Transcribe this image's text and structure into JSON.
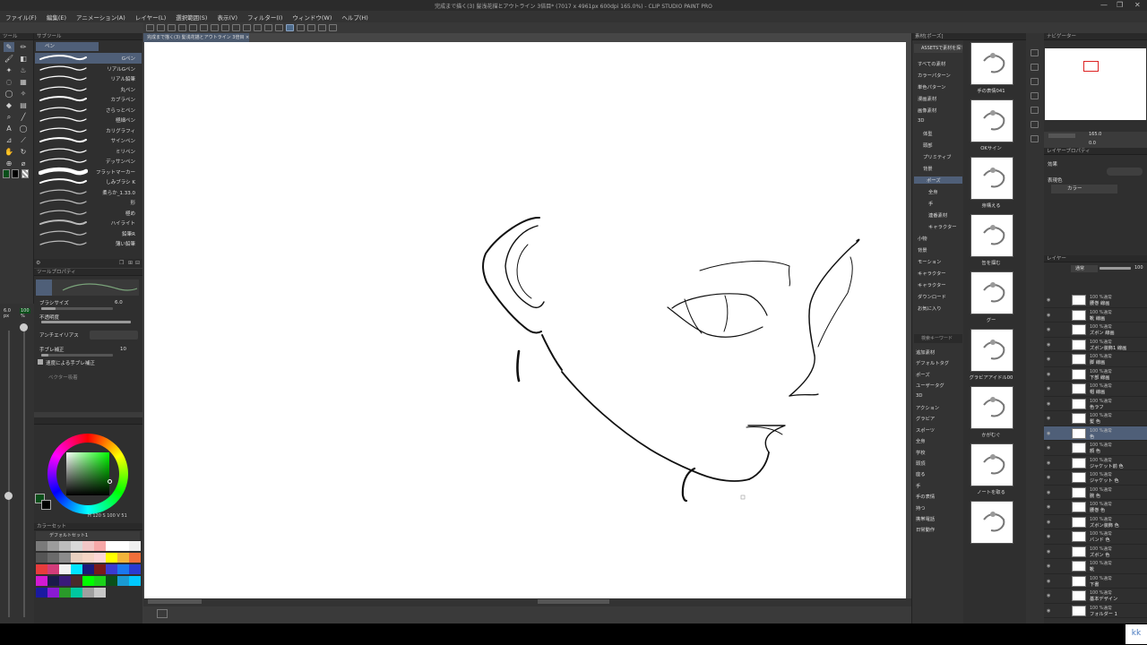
{
  "title_bar": {
    "text": "完成まで描く(3) 髪浅花描とアウトライン 3倍目* (7017 x 4961px 600dpi 165.0%) - CLIP STUDIO PAINT PRO"
  },
  "menu": [
    "ファイル(F)",
    "編集(E)",
    "アニメーション(A)",
    "レイヤー(L)",
    "選択範囲(S)",
    "表示(V)",
    "フィルター(I)",
    "ウィンドウ(W)",
    "ヘルプ(H)"
  ],
  "document_tab": "完成まで描く(3) 髪浅花描とアウトライン 3倍目 ×",
  "tool_panel": {
    "header": "ツール",
    "subtool_header": "サブツール",
    "group_tab": "ペン"
  },
  "brushes": [
    "Gペン",
    "リアルGペン",
    "リアル鉛筆",
    "丸ペン",
    "カブラペン",
    "さらっとペン",
    "極細ペン",
    "カリグラフィ",
    "サインペン",
    "ミリペン",
    "デッサンペン",
    "フラットマーカー",
    "しみブラシ K",
    "柔らか_1.33.0",
    "形",
    "極め",
    "ハイライト",
    "鉛筆R",
    "薄い鉛筆"
  ],
  "tool_property": {
    "header": "ツールプロパティ",
    "brush_size_label": "ブラシサイズ",
    "brush_size_value": "6.0",
    "opacity_label": "不透明度",
    "antialias_label": "アンチエイリアス",
    "stabilization_label": "手ブレ補正",
    "stabilization_value": "10",
    "speed_stab_label": "速度による手ブレ補正",
    "vector_label": "ベクター吸着"
  },
  "brush_size_panel": {
    "size": "6.0",
    "opacity": "100"
  },
  "color_panel": {
    "values": "H 120  S 100  V 51",
    "main_color": "#0a4f1a"
  },
  "color_set": {
    "header": "カラーセット",
    "name": "デフォルトセット1",
    "swatches": [
      "#7a7a7a",
      "#9c9c9c",
      "#bdbdbd",
      "#d9d9d9",
      "#f2c6c6",
      "#f7a8a8",
      "#ffffff",
      "#ffffff",
      "#f0f0f0",
      "#555555",
      "#6b6b6b",
      "#8c8c8c",
      "#e8d0c0",
      "#f5d5c5",
      "#fcd7d7",
      "#ffff00",
      "#f2b43a",
      "#f26f3a",
      "#e83c3c",
      "#d23c7a",
      "#f2f2f2",
      "#00e5ff",
      "#1a1a7a",
      "#7a1a1a",
      "#3a3ad2",
      "#1a78f0",
      "#2a3ad2",
      "#d21ad2",
      "#1a1a4a",
      "#3a1a7a",
      "#4a2a2a",
      "#00ff00",
      "#1ad21a",
      "#0a4f1a",
      "#1a9ad2",
      "#00c8ff",
      "#1a1aa0",
      "#8a1ad2",
      "#2a9a2a",
      "#00c8a0",
      "#a0a0a0",
      "#c8c8c8"
    ]
  },
  "material_tree": {
    "header": "素材[ポーズ]",
    "search_label": "ASSETSで素材を探す",
    "items": [
      "すべての素材",
      "カラーパターン",
      "単色パターン",
      "漫画素材",
      "画像素材",
      "3D",
      "体型",
      "頭部",
      "プリミティブ",
      "背景",
      "ポーズ",
      "全身",
      "手",
      "連番素材",
      "キャラクター",
      "小物",
      "背景",
      "モーション",
      "キャラクター",
      "キャラクター",
      "ダウンロード",
      "お気に入り"
    ],
    "search_placeholder": "検索キーワード",
    "tags": [
      "追加素材",
      "デフォルトタグ",
      "ポーズ",
      "ユーザータグ",
      "3D",
      "アクション",
      "グラビア",
      "スポーツ",
      "全身",
      "学校",
      "頭頂",
      "座る",
      "手",
      "手の表情",
      "持つ",
      "携帯電話",
      "日常動作"
    ]
  },
  "pose_thumbnails": [
    "手の表情041",
    "OKサイン",
    "身構える",
    "缶を掴む",
    "グー",
    "グラビアアイドル00",
    "かがむぐ",
    "ノートを取る",
    ""
  ],
  "navigator": {
    "header": "ナビゲーター",
    "zoom": "165.0",
    "rotation": "0.0"
  },
  "layer_property": {
    "header": "レイヤープロパティ",
    "effect_label": "効果",
    "color_label": "表現色",
    "color_value": "カラー"
  },
  "layer_panel": {
    "header": "レイヤー",
    "blend_mode": "通常",
    "opacity": "100",
    "layers": [
      {
        "l1": "100 %通常",
        "l2": "腰巻 線画",
        "sel": false
      },
      {
        "l1": "100 %通常",
        "l2": "靴 線画",
        "sel": false
      },
      {
        "l1": "100 %通常",
        "l2": "ズボン 線画",
        "sel": false
      },
      {
        "l1": "100 %通常",
        "l2": "ズボン装飾1 線画",
        "sel": false
      },
      {
        "l1": "100 %通常",
        "l2": "脚 線画",
        "sel": false
      },
      {
        "l1": "100 %通常",
        "l2": "下部 線画",
        "sel": false
      },
      {
        "l1": "100 %通常",
        "l2": "帽 線画",
        "sel": false
      },
      {
        "l1": "100 %通常",
        "l2": "色ラフ",
        "sel": false
      },
      {
        "l1": "100 %通常",
        "l2": "髪 色",
        "sel": false
      },
      {
        "l1": "100 %通常",
        "l2": "色",
        "sel": true
      },
      {
        "l1": "100 %通常",
        "l2": "顔 色",
        "sel": false
      },
      {
        "l1": "100 %通常",
        "l2": "ジャケット前 色",
        "sel": false
      },
      {
        "l1": "100 %通常",
        "l2": "ジャケット 色",
        "sel": false
      },
      {
        "l1": "100 %通常",
        "l2": "腕 色",
        "sel": false
      },
      {
        "l1": "100 %通常",
        "l2": "腰巻 色",
        "sel": false
      },
      {
        "l1": "100 %通常",
        "l2": "ズボン装飾 色",
        "sel": false
      },
      {
        "l1": "100 %通常",
        "l2": "バンド 色",
        "sel": false
      },
      {
        "l1": "100 %通常",
        "l2": "ズボン 色",
        "sel": false
      },
      {
        "l1": "100 %通常",
        "l2": "靴",
        "sel": false
      },
      {
        "l1": "100 %通常",
        "l2": "下書",
        "sel": false
      },
      {
        "l1": "100 %通常",
        "l2": "基本デザイン",
        "sel": false
      },
      {
        "l1": "100 %通常",
        "l2": "フォルダー 1",
        "sel": false
      }
    ]
  },
  "watermark": "kk"
}
